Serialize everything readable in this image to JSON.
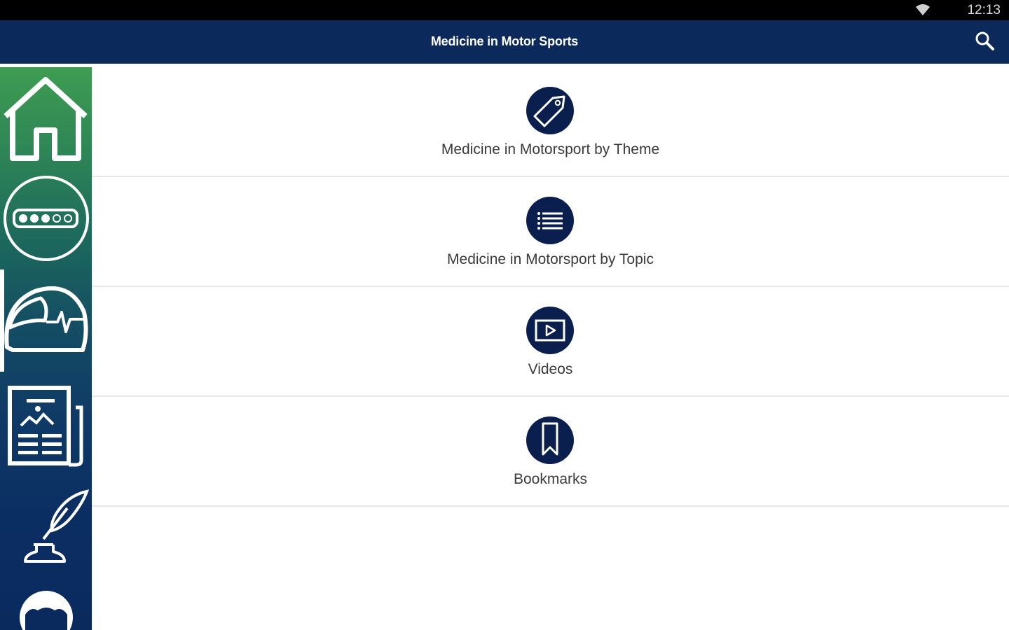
{
  "status_bar": {
    "time": "12:13",
    "wifi_icon": "wifi-icon"
  },
  "app_bar": {
    "title": "Medicine in  Motor Sports",
    "search_icon": "search-icon"
  },
  "sidebar": {
    "items": [
      {
        "icon": "home-icon",
        "active": false
      },
      {
        "icon": "progress-dots-icon",
        "active": false
      },
      {
        "icon": "helmet-heartbeat-icon",
        "active": true
      },
      {
        "icon": "newspaper-icon",
        "active": false
      },
      {
        "icon": "quill-inkwell-icon",
        "active": false
      },
      {
        "icon": "avatar-icon",
        "active": false
      }
    ]
  },
  "menu": {
    "items": [
      {
        "label": "Medicine in Motorsport by Theme",
        "icon": "tag-icon"
      },
      {
        "label": "Medicine in Motorsport by Topic",
        "icon": "list-icon"
      },
      {
        "label": "Videos",
        "icon": "video-play-icon"
      },
      {
        "label": "Bookmarks",
        "icon": "bookmark-icon"
      }
    ]
  },
  "colors": {
    "app_bar": "#0b2a5b",
    "status_bar": "#000000",
    "sidebar_top": "#3e9c52",
    "sidebar_bottom": "#0a2a5e",
    "icon_circle": "#0b1f4e",
    "label_text": "#3b3b3b",
    "divider": "#e7e7e7"
  }
}
